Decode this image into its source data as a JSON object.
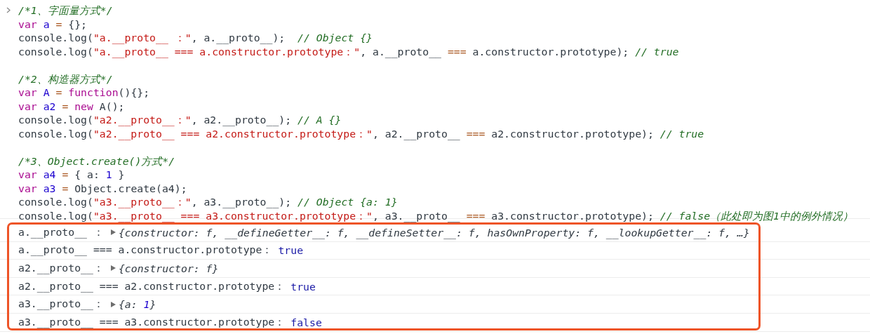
{
  "code_blocks": [
    {
      "lines": [
        [
          {
            "kind": "comment",
            "text": "/*1、字面量方式*/"
          }
        ],
        [
          {
            "kind": "keyword",
            "text": "var "
          },
          {
            "kind": "variable",
            "text": "a"
          },
          {
            "kind": "operator",
            "text": " = "
          },
          {
            "kind": "plain",
            "text": "{};"
          }
        ],
        [
          {
            "kind": "plain",
            "text": "console.log("
          },
          {
            "kind": "string",
            "text": "\"a.__proto__ ：\""
          },
          {
            "kind": "plain",
            "text": ", a.__proto__);  "
          },
          {
            "kind": "comment",
            "text": "// Object {}"
          }
        ],
        [
          {
            "kind": "plain",
            "text": "console.log("
          },
          {
            "kind": "string",
            "text": "\"a.__proto__ === a.constructor.prototype：\""
          },
          {
            "kind": "plain",
            "text": ", a.__proto__ "
          },
          {
            "kind": "operator",
            "text": "==="
          },
          {
            "kind": "plain",
            "text": " a.constructor.prototype); "
          },
          {
            "kind": "comment",
            "text": "// true"
          }
        ]
      ]
    },
    {
      "lines": [
        [
          {
            "kind": "comment",
            "text": "/*2、构造器方式*/"
          }
        ],
        [
          {
            "kind": "keyword",
            "text": "var "
          },
          {
            "kind": "variable",
            "text": "A"
          },
          {
            "kind": "operator",
            "text": " = "
          },
          {
            "kind": "keyword",
            "text": "function"
          },
          {
            "kind": "plain",
            "text": "(){};"
          }
        ],
        [
          {
            "kind": "keyword",
            "text": "var "
          },
          {
            "kind": "variable",
            "text": "a2"
          },
          {
            "kind": "operator",
            "text": " = "
          },
          {
            "kind": "keyword",
            "text": "new"
          },
          {
            "kind": "plain",
            "text": " A();"
          }
        ],
        [
          {
            "kind": "plain",
            "text": "console.log("
          },
          {
            "kind": "string",
            "text": "\"a2.__proto__：\""
          },
          {
            "kind": "plain",
            "text": ", a2.__proto__); "
          },
          {
            "kind": "comment",
            "text": "// A {}"
          }
        ],
        [
          {
            "kind": "plain",
            "text": "console.log("
          },
          {
            "kind": "string",
            "text": "\"a2.__proto__ === a2.constructor.prototype：\""
          },
          {
            "kind": "plain",
            "text": ", a2.__proto__ "
          },
          {
            "kind": "operator",
            "text": "==="
          },
          {
            "kind": "plain",
            "text": " a2.constructor.prototype); "
          },
          {
            "kind": "comment",
            "text": "// true"
          }
        ]
      ]
    },
    {
      "lines": [
        [
          {
            "kind": "comment",
            "text": "/*3、Object.create()方式*/"
          }
        ],
        [
          {
            "kind": "keyword",
            "text": "var "
          },
          {
            "kind": "variable",
            "text": "a4"
          },
          {
            "kind": "operator",
            "text": " = "
          },
          {
            "kind": "plain",
            "text": "{ a: "
          },
          {
            "kind": "number",
            "text": "1"
          },
          {
            "kind": "plain",
            "text": " }"
          }
        ],
        [
          {
            "kind": "keyword",
            "text": "var "
          },
          {
            "kind": "variable",
            "text": "a3"
          },
          {
            "kind": "operator",
            "text": " = "
          },
          {
            "kind": "plain",
            "text": "Object.create(a4);"
          }
        ],
        [
          {
            "kind": "plain",
            "text": "console.log("
          },
          {
            "kind": "string",
            "text": "\"a3.__proto__：\""
          },
          {
            "kind": "plain",
            "text": ", a3.__proto__); "
          },
          {
            "kind": "comment",
            "text": "// Object {a: 1}"
          }
        ],
        [
          {
            "kind": "plain",
            "text": "console.log("
          },
          {
            "kind": "string",
            "text": "\"a3.__proto__ === a3.constructor.prototype：\""
          },
          {
            "kind": "plain",
            "text": ", a3.__proto__ "
          },
          {
            "kind": "operator",
            "text": "==="
          },
          {
            "kind": "plain",
            "text": " a3.constructor.prototype); "
          },
          {
            "kind": "comment",
            "text": "// false（此处即为图1中的例外情况）"
          }
        ]
      ]
    }
  ],
  "output": {
    "highlighted": true,
    "rows": [
      {
        "kind": "object",
        "label": "a.__proto__ ：",
        "value": [
          {
            "kind": "preview",
            "text": "{constructor: f, __defineGetter__: f, __defineSetter__: f, hasOwnProperty: f, __lookupGetter__: f, …}"
          }
        ]
      },
      {
        "kind": "boolean",
        "label": "a.__proto__ === a.constructor.prototype：",
        "value": "true"
      },
      {
        "kind": "object",
        "label": "a2.__proto__：",
        "value": [
          {
            "kind": "preview",
            "text": "{constructor: f}"
          }
        ]
      },
      {
        "kind": "boolean",
        "label": "a2.__proto__ === a2.constructor.prototype：",
        "value": "true"
      },
      {
        "kind": "object",
        "label": "a3.__proto__：",
        "value": [
          {
            "kind": "preview",
            "text": "{a: "
          },
          {
            "kind": "number",
            "text": "1"
          },
          {
            "kind": "preview",
            "text": "}"
          }
        ]
      },
      {
        "kind": "boolean",
        "label": "a3.__proto__ === a3.constructor.prototype：",
        "value": "false"
      }
    ]
  }
}
